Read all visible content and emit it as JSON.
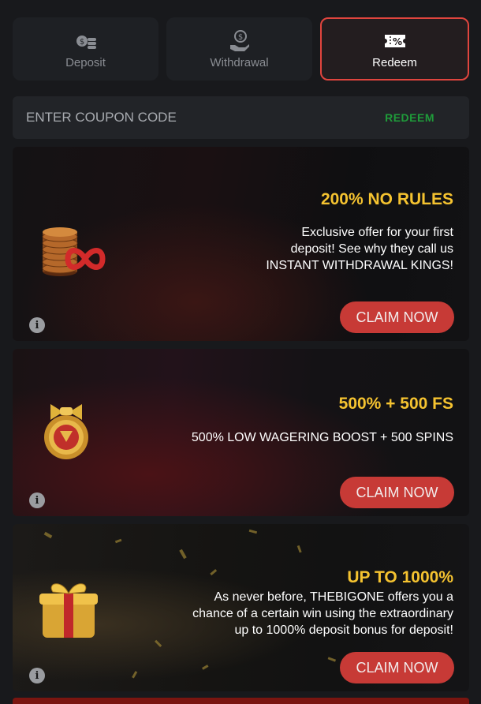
{
  "tabs": [
    {
      "label": "Deposit",
      "icon": "coins-icon"
    },
    {
      "label": "Withdrawal",
      "icon": "hand-money-icon"
    },
    {
      "label": "Redeem",
      "icon": "coupon-icon"
    }
  ],
  "coupon": {
    "placeholder": "ENTER COUPON CODE",
    "value": "",
    "action_label": "REDEEM"
  },
  "promotions": [
    {
      "title": "200% NO RULES",
      "description_lines": [
        "Exclusive offer for your first",
        "deposit! See why they call us",
        "INSTANT WITHDRAWAL KINGS!"
      ],
      "button": "CLAIM NOW",
      "icon": "coins-infinity-icon"
    },
    {
      "title": "500% + 500 FS",
      "description_lines": [
        "500% LOW WAGERING BOOST + 500 SPINS"
      ],
      "button": "CLAIM NOW",
      "icon": "medal-icon"
    },
    {
      "title": "UP TO 1000%",
      "description_lines": [
        "As never before, THEBIGONE offers you a",
        "chance of a certain win using the extraordinary",
        "up to 1000% deposit bonus for deposit!"
      ],
      "button": "CLAIM NOW",
      "icon": "gift-box-icon"
    }
  ],
  "colors": {
    "accent": "#e0453e",
    "button": "#c73a36",
    "title": "#f5c330",
    "redeem_link": "#1f9b3a"
  }
}
